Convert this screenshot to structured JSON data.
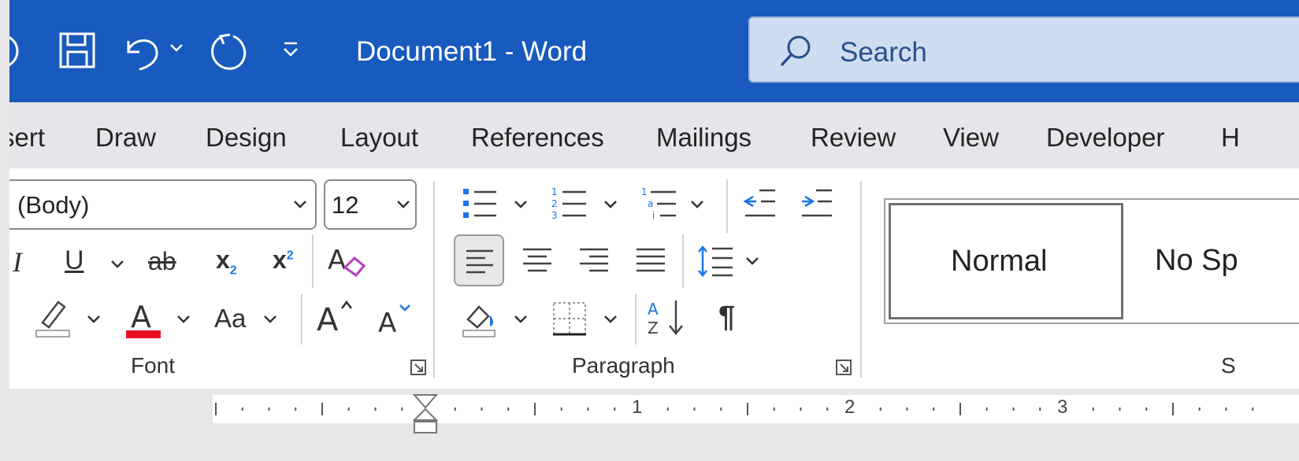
{
  "titlebar": {
    "doc_title": "Document1  -  Word",
    "search_placeholder": "Search"
  },
  "tabs": [
    "sert",
    "Draw",
    "Design",
    "Layout",
    "References",
    "Mailings",
    "Review",
    "View",
    "Developer",
    "H"
  ],
  "font_group": {
    "font_name": "(Body)",
    "font_size": "12",
    "label": "Font",
    "change_case_label": "Aa"
  },
  "paragraph_group": {
    "label": "Paragraph"
  },
  "styles_group": {
    "items": [
      "Normal",
      "No Sp"
    ],
    "label": "S"
  },
  "ruler": {
    "numbers": [
      "1",
      "2",
      "3"
    ]
  },
  "colors": {
    "title_bar": "#185abd",
    "font_color_bar": "#e81123",
    "highlight_bar": "#ffffff"
  }
}
